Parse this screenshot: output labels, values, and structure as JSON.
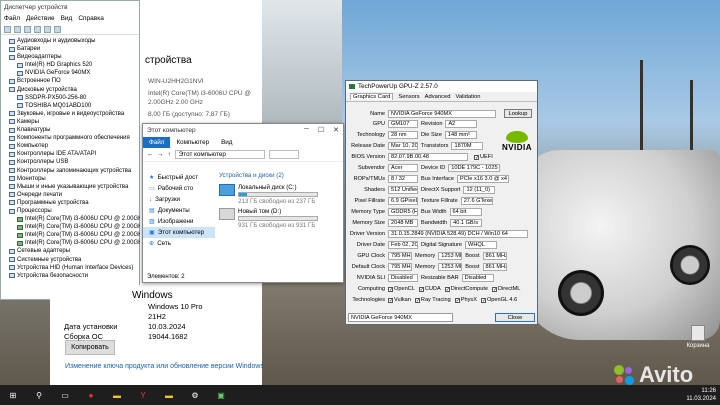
{
  "device_manager": {
    "title": "Диспетчер устройств",
    "menu": [
      "Файл",
      "Действие",
      "Вид",
      "Справка"
    ],
    "tree": [
      {
        "label": "Аудиовходы и аудиовыходы",
        "indent": 1
      },
      {
        "label": "Батареи",
        "indent": 1
      },
      {
        "label": "Видеоадаптеры",
        "indent": 1
      },
      {
        "label": "Intel(R) HD Graphics 520",
        "indent": 2
      },
      {
        "label": "NVIDIA GeForce 940MX",
        "indent": 2
      },
      {
        "label": "Встроенное ПО",
        "indent": 1
      },
      {
        "label": "Дисковые устройства",
        "indent": 1
      },
      {
        "label": "SSDPR-PX500-256-80",
        "indent": 2
      },
      {
        "label": "TOSHIBA MQ01ABD100",
        "indent": 2
      },
      {
        "label": "Звуковые, игровые и видеоустройства",
        "indent": 1
      },
      {
        "label": "Камеры",
        "indent": 1
      },
      {
        "label": "Клавиатуры",
        "indent": 1
      },
      {
        "label": "Компоненты программного обеспечения",
        "indent": 1
      },
      {
        "label": "Компьютер",
        "indent": 1
      },
      {
        "label": "Контроллеры IDE ATA/ATAPI",
        "indent": 1
      },
      {
        "label": "Контроллеры USB",
        "indent": 1
      },
      {
        "label": "Контроллеры запоминающих устройства",
        "indent": 1
      },
      {
        "label": "Мониторы",
        "indent": 1
      },
      {
        "label": "Мыши и иные указывающие устройства",
        "indent": 1
      },
      {
        "label": "Очереди печати",
        "indent": 1
      },
      {
        "label": "Программные устройства",
        "indent": 1
      },
      {
        "label": "Процессоры",
        "indent": 1
      },
      {
        "label": "Intel(R) Core(TM) i3-6006U CPU @ 2.00GHz",
        "indent": 2
      },
      {
        "label": "Intel(R) Core(TM) i3-6006U CPU @ 2.00GHz",
        "indent": 2
      },
      {
        "label": "Intel(R) Core(TM) i3-6006U CPU @ 2.00GHz",
        "indent": 2
      },
      {
        "label": "Intel(R) Core(TM) i3-6006U CPU @ 2.00GHz",
        "indent": 2
      },
      {
        "label": "Сетевые адаптеры",
        "indent": 1
      },
      {
        "label": "Системные устройства",
        "indent": 1
      },
      {
        "label": "Устройства HID (Human Interface Devices)",
        "indent": 1
      },
      {
        "label": "Устройства безопасности",
        "indent": 1
      }
    ]
  },
  "system": {
    "heading": "стройства",
    "device_name": "WIN-U2HH2G1NVI",
    "cpu_line1": "Intel(R) Core(TM) i3-6006U CPU @",
    "cpu_line2": "2.00GHz   2.00 GHz",
    "ram": "8,00 ГБ (доступно: 7,87 ГБ)"
  },
  "windows_spec": {
    "heading": "Windows",
    "rows": [
      {
        "k": "",
        "v": "Windows 10 Pro"
      },
      {
        "k": "",
        "v": "21H2"
      },
      {
        "k": "Дата установки",
        "v": "10.03.2024"
      },
      {
        "k": "Сборка ОС",
        "v": "19044.1682"
      }
    ],
    "copy_button": "Копировать",
    "link": "Изменение ключа продукта или обновление версии Windows"
  },
  "explorer": {
    "title": "Этот компьютер",
    "tabs": [
      "Файл",
      "Компьютер",
      "Вид"
    ],
    "address": "Этот компьютер",
    "nav": [
      "Быстрый дост",
      "Рабочий сто",
      "Загрузки",
      "Документы",
      "Изображени",
      "Этот компьютер",
      "Сеть"
    ],
    "section": "Устройства и диски (2)",
    "drives": [
      {
        "name": "Локальный диск (C:)",
        "free": "213 ГБ свободно из 237 ГБ",
        "used_fraction": 0.1
      },
      {
        "name": "Новый том (D:)",
        "free": "931 ГБ свободно из 931 ГБ",
        "used_fraction": 0.0
      }
    ],
    "status": "Элементов: 2"
  },
  "gpuz": {
    "title": "TechPowerUp GPU-Z 2.57.0",
    "tabs": [
      "Graphics Card",
      "Sensors",
      "Advanced",
      "Validation"
    ],
    "lookup": "Lookup",
    "rows": {
      "name": {
        "label": "Name",
        "value": "NVIDIA GeForce 940MX"
      },
      "gpu": {
        "label": "GPU",
        "value": "GM107",
        "label2": "Revision",
        "value2": "A2"
      },
      "technology": {
        "label": "Technology",
        "value": "28 nm",
        "label2": "Die Size",
        "value2": "148 mm²"
      },
      "release": {
        "label": "Release Date",
        "value": "Mar 10, 2016",
        "label2": "Transistors",
        "value2": "1870M"
      },
      "bios": {
        "label": "BIOS Version",
        "value": "82.07.9B.00.48",
        "uefi": "UEFI"
      },
      "subvendor": {
        "label": "Subvendor",
        "value": "Acer",
        "label2": "Device ID",
        "value2": "10DE 179C - 1025 1094"
      },
      "rops": {
        "label": "ROPs/TMUs",
        "value": "8 / 32",
        "label2": "Bus Interface",
        "value2": "PCIe x16 3.0 @ x4 1.1"
      },
      "shaders": {
        "label": "Shaders",
        "value": "512 Unified",
        "label2": "DirectX Support",
        "value2": "12 (11_0)"
      },
      "pixel": {
        "label": "Pixel Fillrate",
        "value": "6.9 GPixel/s",
        "label2": "Texture Fillrate",
        "value2": "27.6 GTexel/s"
      },
      "memtype": {
        "label": "Memory Type",
        "value": "GDDR5 (Hynix)",
        "label2": "Bus Width",
        "value2": "64 bit"
      },
      "memsize": {
        "label": "Memory Size",
        "value": "2048 MB",
        "label2": "Bandwidth",
        "value2": "40.1 GB/s"
      },
      "driver": {
        "label": "Driver Version",
        "value": "31.0.15.2849 (NVIDIA 528.49) DCH / Win10 64"
      },
      "driverdate": {
        "label": "Driver Date",
        "value": "Feb 02, 2023",
        "label2": "Digital Signature",
        "value2": "WHQL"
      },
      "gpuclock": {
        "label": "GPU Clock",
        "value": "795 MHz",
        "label2": "Memory",
        "value2": "1253 MHz",
        "label3": "Boost",
        "value3": "861 MHz"
      },
      "defclock": {
        "label": "Default Clock",
        "value": "795 MHz",
        "label2": "Memory",
        "value2": "1253 MHz",
        "label3": "Boost",
        "value3": "861 MHz"
      },
      "sli": {
        "label": "NVIDIA SLI",
        "value": "Disabled",
        "label2": "Resizable BAR",
        "value2": "Disabled"
      },
      "computing": {
        "label": "Computing",
        "items": [
          "OpenCL",
          "CUDA",
          "DirectCompute",
          "DirectML"
        ]
      },
      "technologies": {
        "label": "Technologies",
        "items": [
          "Vulkan",
          "Ray Tracing",
          "PhysX",
          "OpenGL 4.6"
        ]
      }
    },
    "select": "NVIDIA GeForce 940MX",
    "close": "Close"
  },
  "desktop": {
    "recycle_bin": "Корзина",
    "watermark": "Avito"
  },
  "taskbar": {
    "time": "11:26",
    "date": "11.03.2024"
  }
}
